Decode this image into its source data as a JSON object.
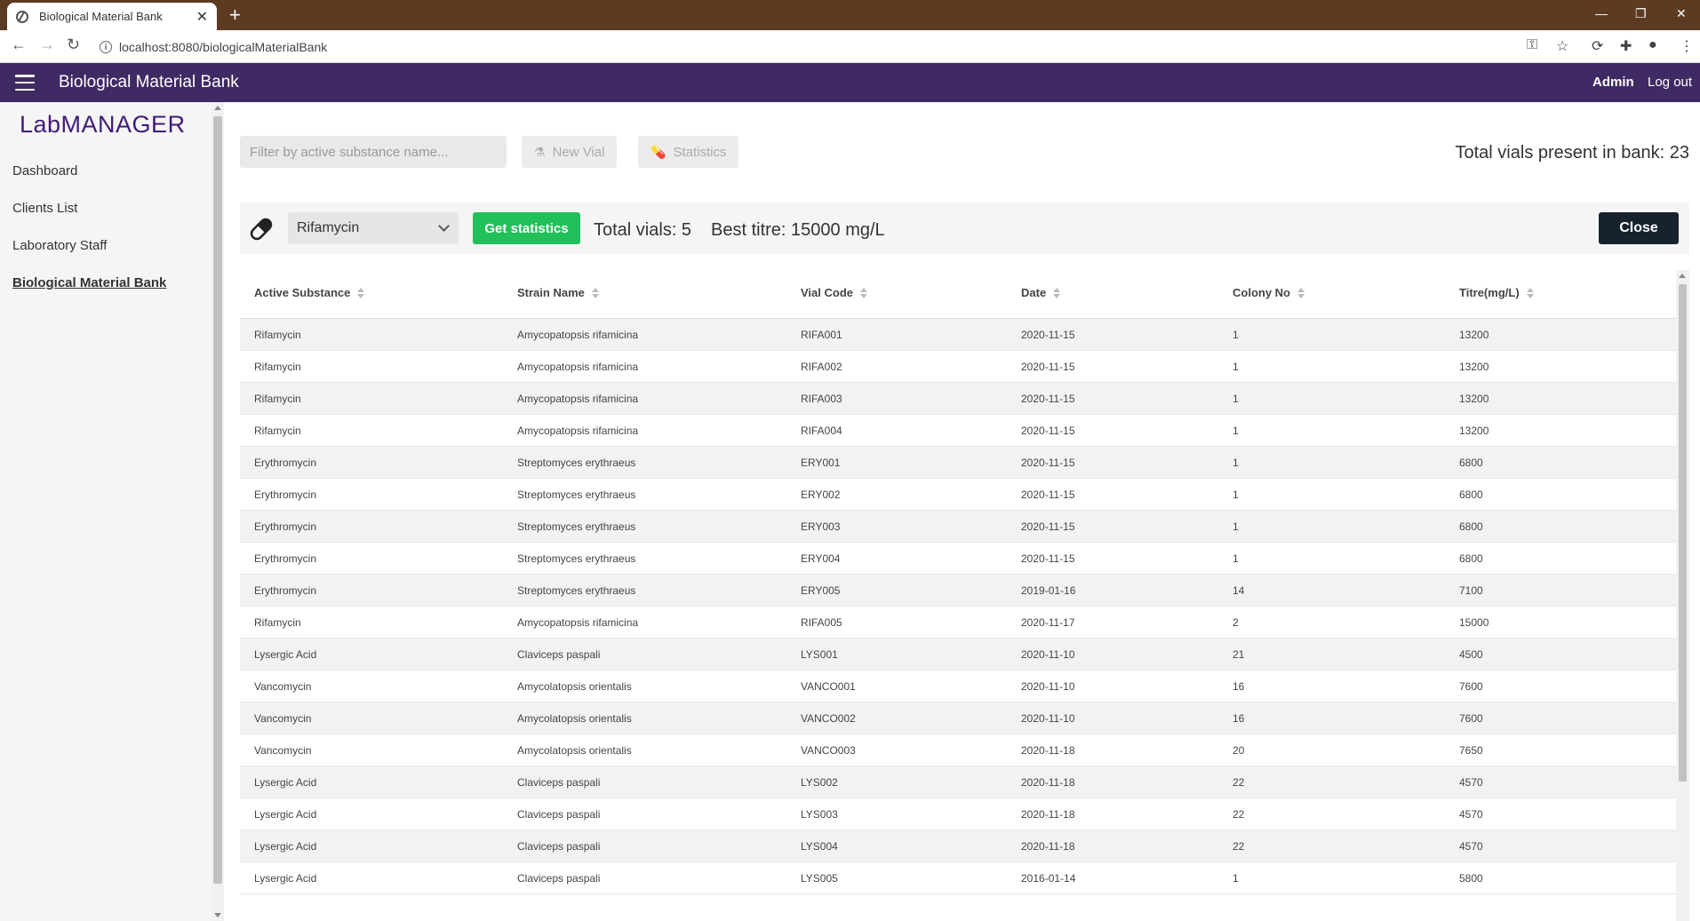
{
  "browser": {
    "tab_title": "Biological Material Bank",
    "url": "localhost:8080/biologicalMaterialBank"
  },
  "header": {
    "title": "Biological Material Bank",
    "user": "Admin",
    "logout": "Log out"
  },
  "sidebar": {
    "brand": "LabMANAGER",
    "items": [
      {
        "label": "Dashboard"
      },
      {
        "label": "Clients List"
      },
      {
        "label": "Laboratory Staff"
      },
      {
        "label": "Biological Material Bank"
      }
    ]
  },
  "toolbar": {
    "filter_placeholder": "Filter by active substance name...",
    "new_vial": "New Vial",
    "statistics": "Statistics",
    "total_bank": "Total vials present in bank: 23"
  },
  "stats": {
    "selected_substance": "Rifamycin",
    "get_statistics": "Get statistics",
    "total_vials": "Total vials: 5",
    "best_titre": "Best titre: 15000 mg/L",
    "close": "Close"
  },
  "colors": {
    "appbar": "#3f2a63",
    "brand": "#3f1c76",
    "get_stats": "#21c05a",
    "close": "#16222e"
  },
  "table": {
    "headers": [
      "Active Substance",
      "Strain Name",
      "Vial Code",
      "Date",
      "Colony No",
      "Titre(mg/L)"
    ],
    "rows": [
      [
        "Rifamycin",
        "Amycopatopsis rifamicina",
        "RIFA001",
        "2020-11-15",
        "1",
        "13200"
      ],
      [
        "Rifamycin",
        "Amycopatopsis rifamicina",
        "RIFA002",
        "2020-11-15",
        "1",
        "13200"
      ],
      [
        "Rifamycin",
        "Amycopatopsis rifamicina",
        "RIFA003",
        "2020-11-15",
        "1",
        "13200"
      ],
      [
        "Rifamycin",
        "Amycopatopsis rifamicina",
        "RIFA004",
        "2020-11-15",
        "1",
        "13200"
      ],
      [
        "Erythromycin",
        "Streptomyces erythraeus",
        "ERY001",
        "2020-11-15",
        "1",
        "6800"
      ],
      [
        "Erythromycin",
        "Streptomyces erythraeus",
        "ERY002",
        "2020-11-15",
        "1",
        "6800"
      ],
      [
        "Erythromycin",
        "Streptomyces erythraeus",
        "ERY003",
        "2020-11-15",
        "1",
        "6800"
      ],
      [
        "Erythromycin",
        "Streptomyces erythraeus",
        "ERY004",
        "2020-11-15",
        "1",
        "6800"
      ],
      [
        "Erythromycin",
        "Streptomyces erythraeus",
        "ERY005",
        "2019-01-16",
        "14",
        "7100"
      ],
      [
        "Rifamycin",
        "Amycopatopsis rifamicina",
        "RIFA005",
        "2020-11-17",
        "2",
        "15000"
      ],
      [
        "Lysergic Acid",
        "Claviceps paspali",
        "LYS001",
        "2020-11-10",
        "21",
        "4500"
      ],
      [
        "Vancomycin",
        "Amycolatopsis orientalis",
        "VANCO001",
        "2020-11-10",
        "16",
        "7600"
      ],
      [
        "Vancomycin",
        "Amycolatopsis orientalis",
        "VANCO002",
        "2020-11-10",
        "16",
        "7600"
      ],
      [
        "Vancomycin",
        "Amycolatopsis orientalis",
        "VANCO003",
        "2020-11-18",
        "20",
        "7650"
      ],
      [
        "Lysergic Acid",
        "Claviceps paspali",
        "LYS002",
        "2020-11-18",
        "22",
        "4570"
      ],
      [
        "Lysergic Acid",
        "Claviceps paspali",
        "LYS003",
        "2020-11-18",
        "22",
        "4570"
      ],
      [
        "Lysergic Acid",
        "Claviceps paspali",
        "LYS004",
        "2020-11-18",
        "22",
        "4570"
      ],
      [
        "Lysergic Acid",
        "Claviceps paspali",
        "LYS005",
        "2016-01-14",
        "1",
        "5800"
      ]
    ]
  }
}
